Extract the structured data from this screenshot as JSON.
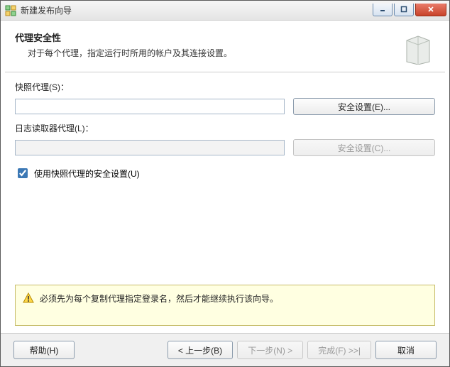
{
  "window": {
    "title": "新建发布向导"
  },
  "header": {
    "title": "代理安全性",
    "subtitle": "对于每个代理，指定运行时所用的帐户及其连接设置。"
  },
  "form": {
    "snapshotAgent": {
      "label": "快照代理(S)：",
      "value": "",
      "securityButton": "安全设置(E)..."
    },
    "logReaderAgent": {
      "label": "日志读取器代理(L)：",
      "value": "",
      "securityButton": "安全设置(C)..."
    },
    "useSnapshotSecurity": {
      "label": "使用快照代理的安全设置(U)",
      "checked": true
    }
  },
  "warning": {
    "text": "必须先为每个复制代理指定登录名，然后才能继续执行该向导。"
  },
  "footer": {
    "help": "帮助(H)",
    "back": "< 上一步(B)",
    "next": "下一步(N) >",
    "finish": "完成(F) >>|",
    "cancel": "取消"
  }
}
